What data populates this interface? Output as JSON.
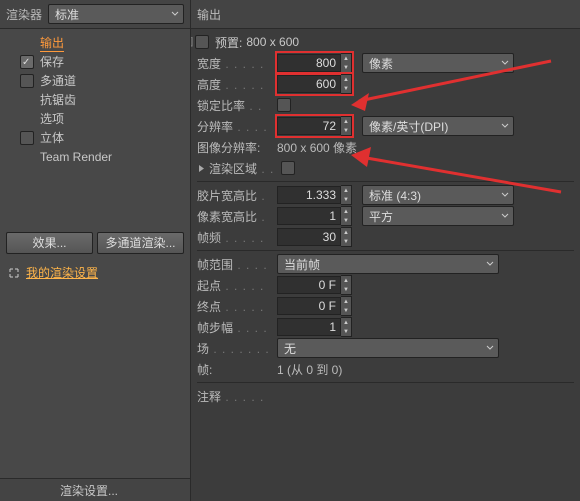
{
  "left": {
    "renderer_label": "渲染器",
    "renderer_value": "标准",
    "tree": [
      {
        "id": "output",
        "label": "输出",
        "selected": true
      },
      {
        "id": "save",
        "label": "保存",
        "checked": true
      },
      {
        "id": "multipass",
        "label": "多通道",
        "checked": false
      },
      {
        "id": "aa",
        "label": "抗锯齿"
      },
      {
        "id": "options",
        "label": "选项"
      },
      {
        "id": "stereo",
        "label": "立体",
        "checked": false
      },
      {
        "id": "team",
        "label": "Team Render"
      }
    ],
    "btn_effects": "效果...",
    "btn_multipass": "多通道渲染...",
    "my_settings": "我的渲染设置",
    "footer": "渲染设置..."
  },
  "out": {
    "title": "输出",
    "preset_lbl": "预置:",
    "preset_val": "800 x 600",
    "width_lbl": "宽度",
    "width_val": "800",
    "height_lbl": "高度",
    "height_val": "600",
    "unit_px": "像素",
    "lock_lbl": "锁定比率",
    "res_lbl": "分辨率",
    "res_val": "72",
    "res_unit": "像素/英寸(DPI)",
    "imgres_lbl": "图像分辨率:",
    "imgres_val": "800 x 600 像素",
    "region_lbl": "渲染区域",
    "film_lbl": "胶片宽高比",
    "film_val": "1.333",
    "film_mode": "标准 (4:3)",
    "px_lbl": "像素宽高比",
    "px_val": "1",
    "px_mode": "平方",
    "fps_lbl": "帧频",
    "fps_val": "30",
    "range_lbl": "帧范围",
    "range_val": "当前帧",
    "start_lbl": "起点",
    "start_val": "0 F",
    "end_lbl": "终点",
    "end_val": "0 F",
    "step_lbl": "帧步幅",
    "step_val": "1",
    "field_lbl": "场",
    "field_val": "无",
    "frames_lbl": "帧:",
    "frames_val": "1 (从 0 到 0)",
    "notes_lbl": "注释"
  }
}
